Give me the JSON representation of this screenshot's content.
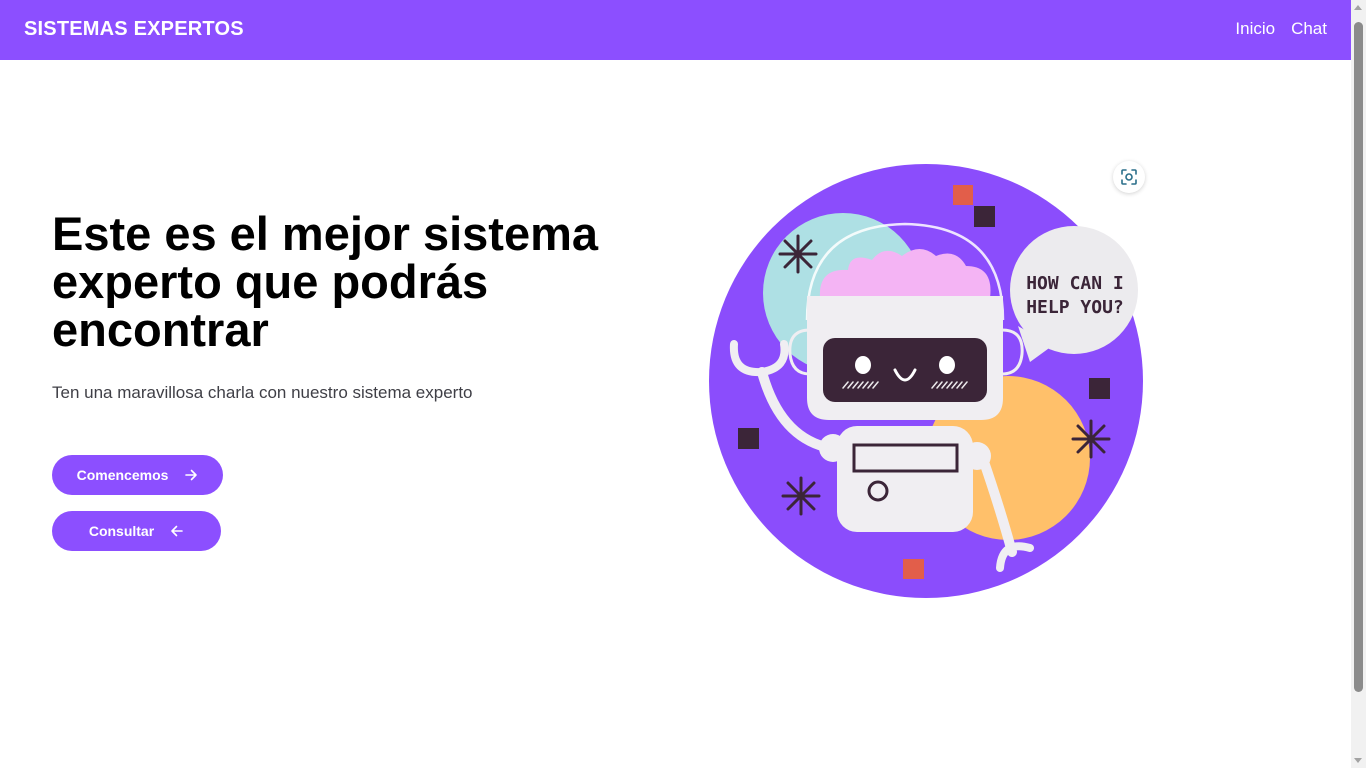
{
  "navbar": {
    "brand": "SISTEMAS EXPERTOS",
    "links": [
      "Inicio",
      "Chat"
    ]
  },
  "hero": {
    "title": "Este es el mejor sistema experto que podrás encontrar",
    "subtitle": "Ten una maravillosa charla con nuestro sistema experto",
    "buttons": {
      "start": {
        "label": "Comencemos",
        "icon": "arrow-right-icon"
      },
      "consult": {
        "label": "Consultar",
        "icon": "arrow-left-icon"
      }
    }
  },
  "illustration": {
    "bubble_line1": "HOW CAN I",
    "bubble_line2": "HELP YOU?",
    "icon": "robot-illustration"
  },
  "overlay": {
    "icon": "screenshot-lens-icon"
  },
  "colors": {
    "brand": "#8c4fff",
    "circle": "#8b4dfc",
    "accent_teal": "#aee0e4",
    "accent_yellow": "#ffc06a",
    "accent_red": "#e25e4a",
    "dark": "#3b2538",
    "brain": "#f4b4f4"
  }
}
